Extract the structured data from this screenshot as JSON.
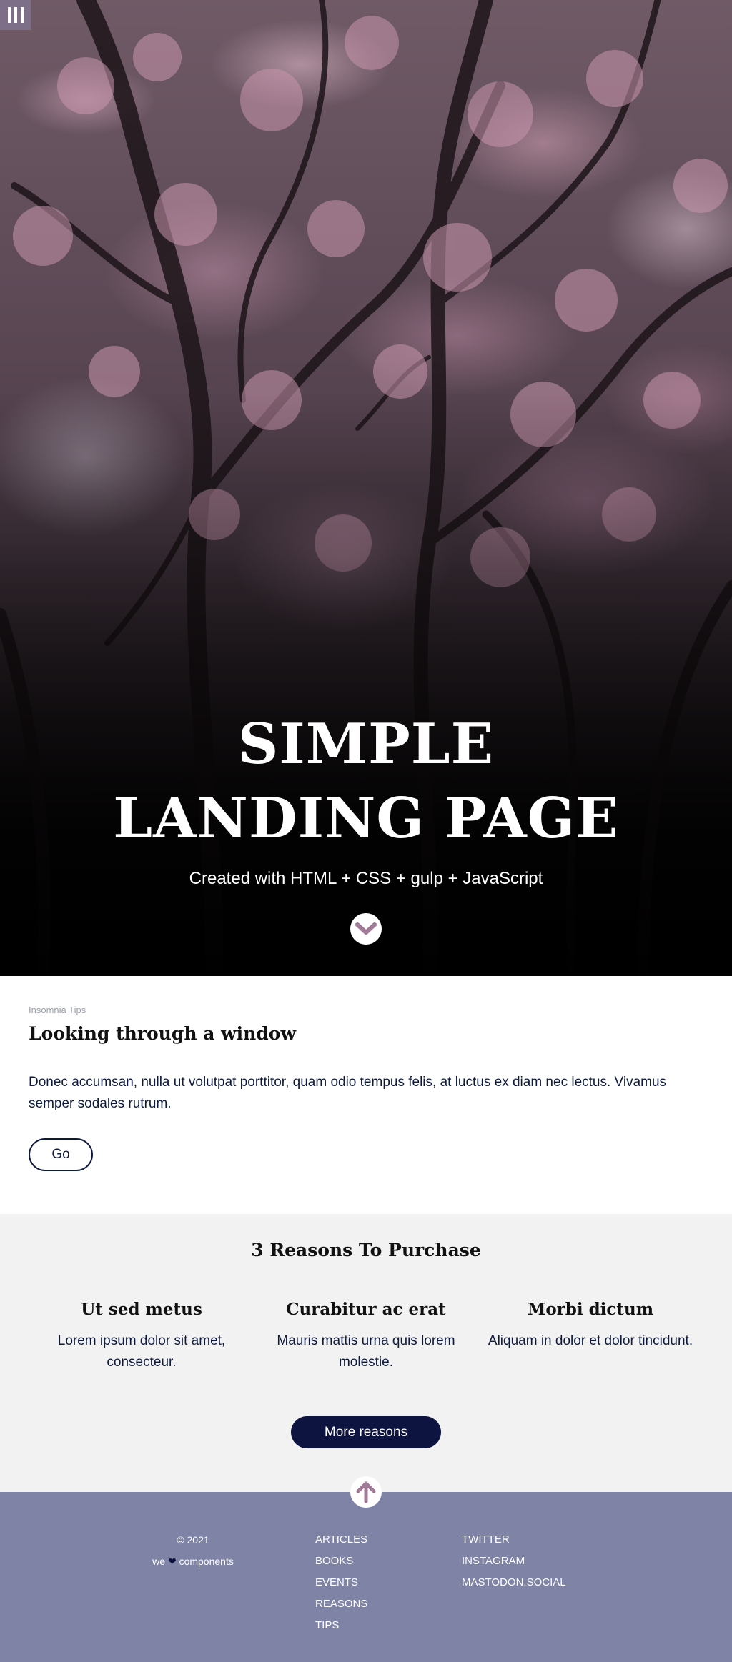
{
  "hero": {
    "title_line1": "SIMPLE",
    "title_line2": "LANDING PAGE",
    "subtitle": "Created with HTML + CSS + gulp + JavaScript"
  },
  "article": {
    "eyebrow": "Insomnia Tips",
    "title": "Looking through a window",
    "body": "Donec accumsan, nulla ut volutpat porttitor, quam odio tempus felis, at luctus ex diam nec lectus. Vivamus semper sodales rutrum.",
    "button_label": "Go"
  },
  "reasons": {
    "title": "3 Reasons To Purchase",
    "items": [
      {
        "title": "Ut sed metus",
        "text": "Lorem ipsum dolor sit amet, consecteur."
      },
      {
        "title": "Curabitur ac erat",
        "text": "Mauris mattis urna quis lorem molestie."
      },
      {
        "title": "Morbi dictum",
        "text": "Aliquam in dolor et dolor tincidunt."
      }
    ],
    "button_label": "More reasons"
  },
  "footer": {
    "copyright": "© 2021",
    "tagline_before": "we",
    "heart": "❤",
    "tagline_after": "components",
    "nav": [
      "ARTICLES",
      "BOOKS",
      "EVENTS",
      "REASONS",
      "TIPS"
    ],
    "social": [
      "TWITTER",
      "INSTAGRAM",
      "MASTODON.SOCIAL"
    ]
  },
  "icons": {
    "menu": "menu-icon",
    "scroll_down": "chevron-down-icon",
    "to_top": "arrow-up-icon"
  },
  "colors": {
    "accent": "#a07a96",
    "navy": "#0e1440",
    "footer_bg": "#7f84a6",
    "reasons_bg": "#f2f2f2"
  }
}
